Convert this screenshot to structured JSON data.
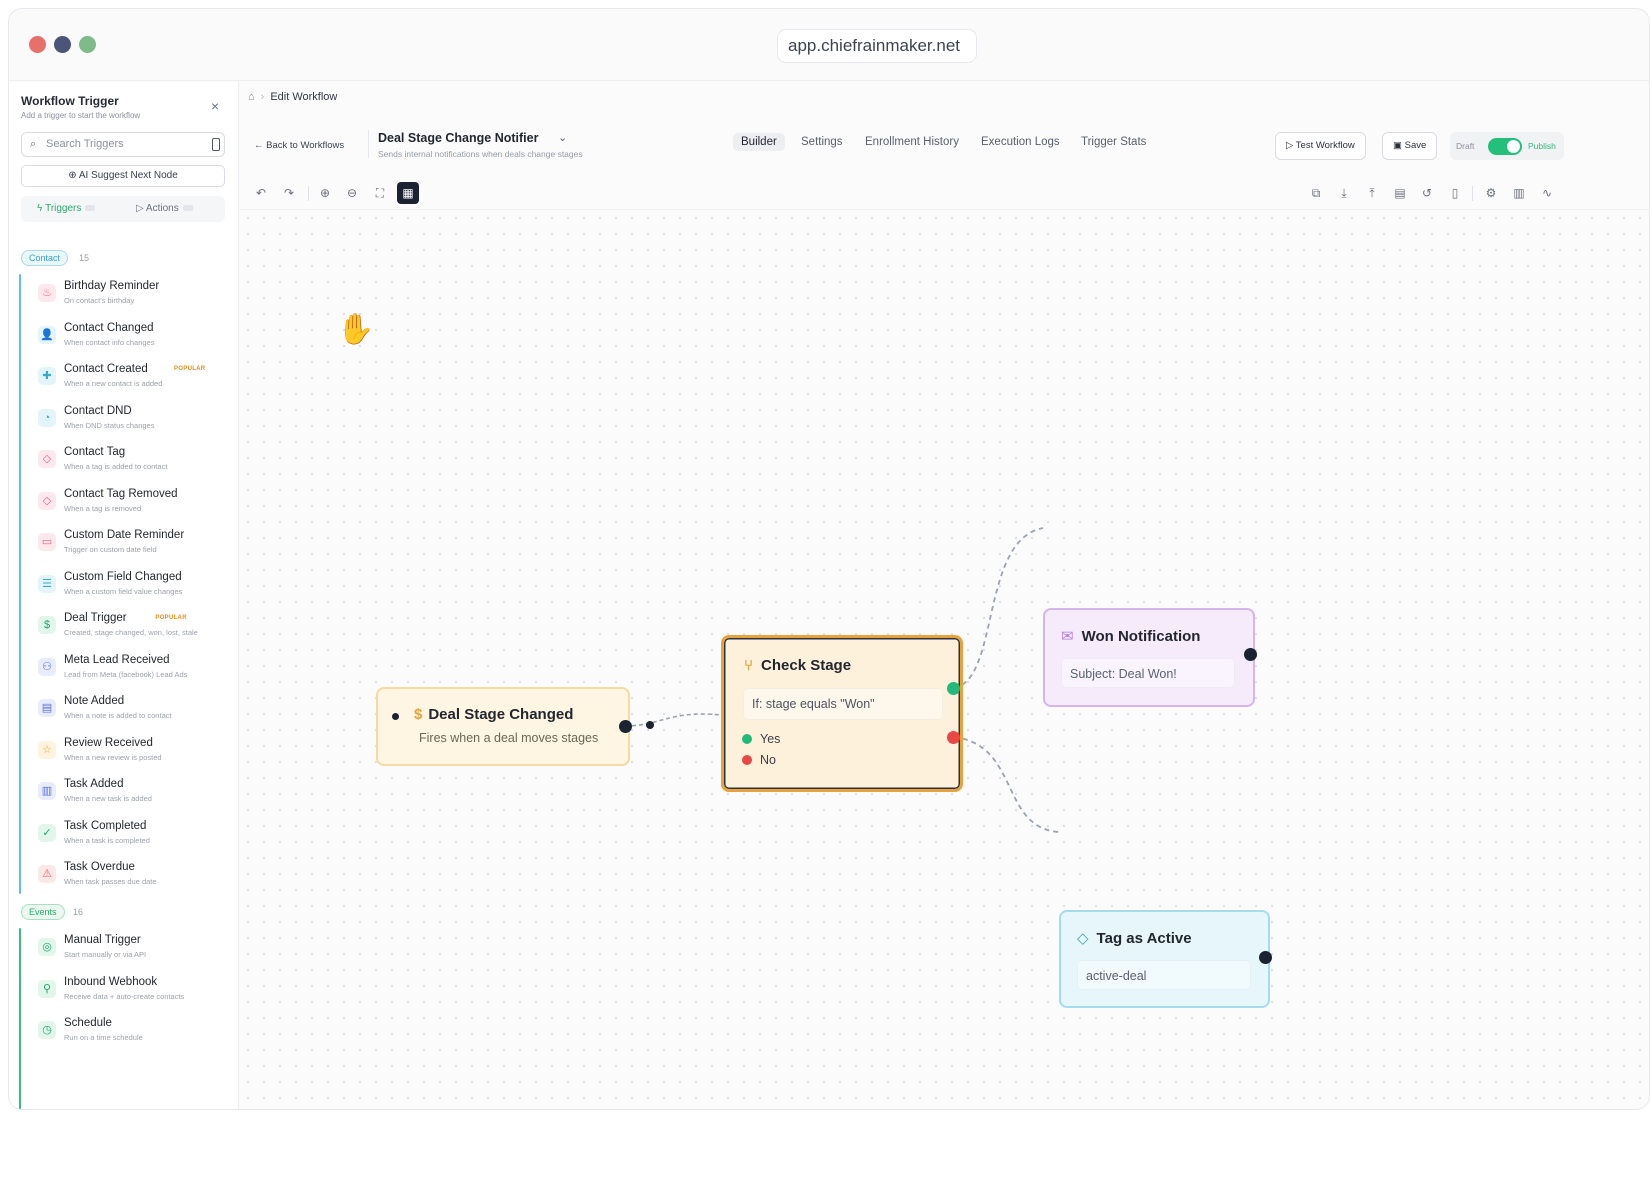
{
  "browser": {
    "url": "app.chiefrainmaker.net",
    "dots": [
      "#e8706b",
      "#4a5577",
      "#7fbb88"
    ]
  },
  "sidebar": {
    "title": "Workflow Trigger",
    "subtitle": "Add a trigger to start the workflow",
    "close": "×",
    "search_placeholder": "Search Triggers",
    "ai_button": "AI Suggest Next Node",
    "tab_triggers": "Triggers",
    "tab_actions": "Actions",
    "contact_category": {
      "label": "Contact",
      "count": "15"
    },
    "events_category": {
      "label": "Events",
      "count": "16"
    },
    "contact_items": [
      {
        "name": "Birthday Reminder",
        "desc": "On contact's birthday",
        "icon": "cake-icon",
        "glyph": "♨",
        "color": "#f06a8a",
        "bg": "#fde8ee"
      },
      {
        "name": "Contact Changed",
        "desc": "When contact info changes",
        "icon": "user-icon",
        "glyph": "👤",
        "color": "#3aa9c9",
        "bg": "#e3f4fa"
      },
      {
        "name": "Contact Created",
        "desc": "When a new contact is added",
        "icon": "user-plus-icon",
        "glyph": "✚",
        "color": "#3aa9c9",
        "bg": "#e3f4fa",
        "pill": "POPULAR"
      },
      {
        "name": "Contact DND",
        "desc": "When DND status changes",
        "icon": "bell-icon",
        "glyph": "◔",
        "color": "#3aa9c9",
        "bg": "#e3f4fa"
      },
      {
        "name": "Contact Tag",
        "desc": "When a tag is added to contact",
        "icon": "tag-icon",
        "glyph": "◇",
        "color": "#ee5d7c",
        "bg": "#fde8ee"
      },
      {
        "name": "Contact Tag Removed",
        "desc": "When a tag is removed",
        "icon": "tag-off-icon",
        "glyph": "◇",
        "color": "#ee5d7c",
        "bg": "#fde8ee"
      },
      {
        "name": "Custom Date Reminder",
        "desc": "Trigger on custom date field",
        "icon": "calendar-icon",
        "glyph": "▭",
        "color": "#ee5d7c",
        "bg": "#fde8ee"
      },
      {
        "name": "Custom Field Changed",
        "desc": "When a custom field value changes",
        "icon": "database-icon",
        "glyph": "☰",
        "color": "#3aa9c9",
        "bg": "#e3f4fa"
      },
      {
        "name": "Deal Trigger",
        "desc": "Created, stage changed, won, lost, stale",
        "icon": "dollar-icon",
        "glyph": "$",
        "color": "#1ea86b",
        "bg": "#e2f6ec",
        "pill": "POPULAR"
      },
      {
        "name": "Meta Lead Received",
        "desc": "Lead from Meta (facebook) Lead Ads",
        "icon": "users-icon",
        "glyph": "⚇",
        "color": "#5a6ee0",
        "bg": "#e9ecfc"
      },
      {
        "name": "Note Added",
        "desc": "When a note is added to contact",
        "icon": "note-icon",
        "glyph": "▤",
        "color": "#5a6ee0",
        "bg": "#e9ecfc"
      },
      {
        "name": "Review Received",
        "desc": "When a new review is posted",
        "icon": "star-icon",
        "glyph": "☆",
        "color": "#e8a32b",
        "bg": "#fdf3df"
      },
      {
        "name": "Task Added",
        "desc": "When a new task is added",
        "icon": "clipboard-icon",
        "glyph": "▥",
        "color": "#5a6ee0",
        "bg": "#e9ecfc"
      },
      {
        "name": "Task Completed",
        "desc": "When a task is completed",
        "icon": "check-circle-icon",
        "glyph": "✓",
        "color": "#1ea86b",
        "bg": "#e2f6ec"
      },
      {
        "name": "Task Overdue",
        "desc": "When task passes due date",
        "icon": "alert-icon",
        "glyph": "⚠",
        "color": "#ee5d5d",
        "bg": "#fde8e8"
      }
    ],
    "events_items": [
      {
        "name": "Manual Trigger",
        "desc": "Start manually or via API",
        "icon": "target-icon",
        "glyph": "◎",
        "color": "#1ea86b",
        "bg": "#e2f6ec"
      },
      {
        "name": "Inbound Webhook",
        "desc": "Receive data + auto-create contacts",
        "icon": "webhook-icon",
        "glyph": "⚲",
        "color": "#1ea86b",
        "bg": "#e2f6ec"
      },
      {
        "name": "Schedule",
        "desc": "Run on a time schedule",
        "icon": "clock-icon",
        "glyph": "◷",
        "color": "#1ea86b",
        "bg": "#e2f6ec"
      }
    ]
  },
  "header": {
    "breadcrumb": "Edit Workflow",
    "back": "Back to Workflows",
    "workflow_name": "Deal Stage Change Notifier",
    "workflow_desc": "Sends internal notifications when deals change stages",
    "tabs": [
      "Builder",
      "Settings",
      "Enrollment History",
      "Execution Logs",
      "Trigger Stats"
    ],
    "test_button": "Test Workflow",
    "save_button": "Save",
    "draft_label": "Draft",
    "publish_label": "Publish"
  },
  "canvas": {
    "trigger_node": {
      "title": "Deal Stage Changed",
      "subtitle": "Fires when a deal moves stages"
    },
    "check_node": {
      "title": "Check Stage",
      "condition": "If: stage equals \"Won\"",
      "yes": "Yes",
      "no": "No"
    },
    "won_node": {
      "title": "Won Notification",
      "field": "Subject: Deal Won!"
    },
    "tag_node": {
      "title": "Tag as Active",
      "field": "active-deal"
    }
  }
}
